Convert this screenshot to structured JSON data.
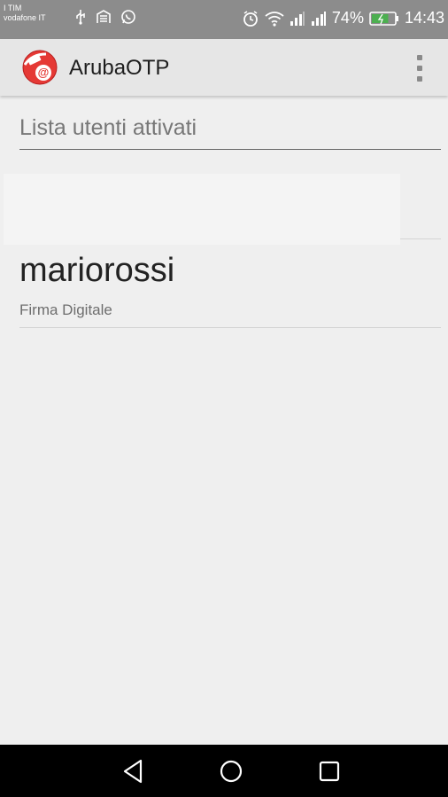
{
  "status_bar": {
    "carrier_1": "I TIM",
    "carrier_2": "vodafone IT",
    "battery_percent": "74%",
    "time": "14:43",
    "battery_level": 0.74,
    "icons_left": [
      "usb-icon",
      "parking-icon",
      "whatsapp-icon"
    ],
    "icons_right": [
      "alarm-icon",
      "wifi-icon",
      "signal-icon",
      "signal-icon",
      "battery-charging-icon"
    ]
  },
  "app_bar": {
    "title": "ArubaOTP",
    "logo_icon": "aruba-otp-logo-icon",
    "menu_icon": "overflow-menu-icon",
    "brand_color": "#e53935"
  },
  "main": {
    "section_title": "Lista utenti attivati",
    "users": [
      {
        "name": "",
        "service": "",
        "redacted": true
      },
      {
        "name": "mariorossi",
        "service": "Firma Digitale",
        "redacted": false
      }
    ]
  },
  "nav_bar": {
    "buttons": [
      "back-icon",
      "home-icon",
      "recent-apps-icon"
    ]
  }
}
